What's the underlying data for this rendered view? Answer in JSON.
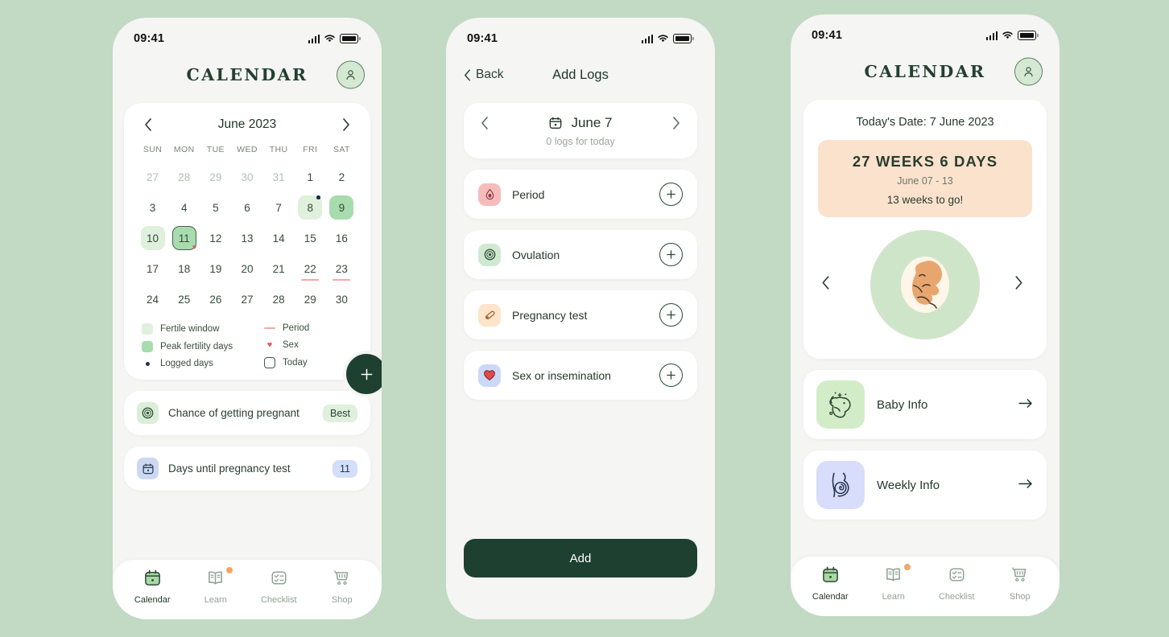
{
  "theme": {
    "background": "#c2d9c4",
    "screen_bg": "#f5f5f4",
    "accent_dark_green": "#1d4030",
    "fertile_green": "#dff0dd",
    "peak_green": "#a8dcae",
    "period_pink": "#f3a9a6",
    "peach": "#fbe2cd"
  },
  "status_bar": {
    "time": "09:41"
  },
  "phone1": {
    "header": {
      "title": "CALENDAR",
      "avatar_icon": "user-icon"
    },
    "calendar": {
      "prev_icon": "chevron-left-icon",
      "next_icon": "chevron-right-icon",
      "month_label": "June 2023",
      "weekday_headers": [
        "SUN",
        "MON",
        "TUE",
        "WED",
        "THU",
        "FRI",
        "SAT"
      ],
      "weeks": [
        [
          {
            "n": "27",
            "state": "muted"
          },
          {
            "n": "28",
            "state": "muted"
          },
          {
            "n": "29",
            "state": "muted"
          },
          {
            "n": "30",
            "state": "muted"
          },
          {
            "n": "31",
            "state": "muted"
          },
          {
            "n": "1",
            "state": ""
          },
          {
            "n": "2",
            "state": ""
          }
        ],
        [
          {
            "n": "3",
            "state": ""
          },
          {
            "n": "4",
            "state": ""
          },
          {
            "n": "5",
            "state": ""
          },
          {
            "n": "6",
            "state": ""
          },
          {
            "n": "7",
            "state": ""
          },
          {
            "n": "8",
            "state": "fertile",
            "dot": true
          },
          {
            "n": "9",
            "state": "peak"
          }
        ],
        [
          {
            "n": "10",
            "state": "fertile"
          },
          {
            "n": "11",
            "state": "today",
            "heart": true
          },
          {
            "n": "12",
            "state": ""
          },
          {
            "n": "13",
            "state": ""
          },
          {
            "n": "14",
            "state": ""
          },
          {
            "n": "15",
            "state": ""
          },
          {
            "n": "16",
            "state": ""
          }
        ],
        [
          {
            "n": "17",
            "state": ""
          },
          {
            "n": "18",
            "state": ""
          },
          {
            "n": "19",
            "state": ""
          },
          {
            "n": "20",
            "state": ""
          },
          {
            "n": "21",
            "state": ""
          },
          {
            "n": "22",
            "state": "",
            "period": true
          },
          {
            "n": "23",
            "state": "",
            "period": true
          }
        ],
        [
          {
            "n": "24",
            "state": ""
          },
          {
            "n": "25",
            "state": ""
          },
          {
            "n": "26",
            "state": ""
          },
          {
            "n": "27",
            "state": ""
          },
          {
            "n": "28",
            "state": ""
          },
          {
            "n": "29",
            "state": ""
          },
          {
            "n": "30",
            "state": ""
          }
        ]
      ],
      "legend_left": [
        {
          "type": "fertile",
          "label": "Fertile window"
        },
        {
          "type": "peak",
          "label": "Peak fertility days"
        },
        {
          "type": "dot",
          "label": "Logged days"
        }
      ],
      "legend_right": [
        {
          "type": "line",
          "label": "Period"
        },
        {
          "type": "heart",
          "label": "Sex"
        },
        {
          "type": "today",
          "label": "Today"
        }
      ],
      "fab_label": "+",
      "fab_icon": "plus-icon"
    },
    "info_rows": [
      {
        "icon": "ovulation-icon",
        "icon_style": "ib-green",
        "label": "Chance of getting pregnant",
        "badge": "Best",
        "badge_style": "badge-green"
      },
      {
        "icon": "calendar-icon",
        "icon_style": "ib-blue",
        "label": "Days until pregnancy test",
        "badge": "11",
        "badge_style": "badge-blue"
      }
    ],
    "tabs": [
      {
        "label": "Calendar",
        "icon": "calendar-icon",
        "active": true,
        "badge": false
      },
      {
        "label": "Learn",
        "icon": "book-icon",
        "active": false,
        "badge": true
      },
      {
        "label": "Checklist",
        "icon": "checklist-icon",
        "active": false,
        "badge": false
      },
      {
        "label": "Shop",
        "icon": "cart-icon",
        "active": false,
        "badge": false
      }
    ]
  },
  "phone2": {
    "header": {
      "back_label": "Back",
      "back_icon": "chevron-left-icon",
      "title": "Add Logs"
    },
    "date_selector": {
      "prev_icon": "chevron-left-icon",
      "next_icon": "chevron-right-icon",
      "calendar_icon": "calendar-icon",
      "date": "June 7",
      "subtitle": "0 logs for today"
    },
    "log_items": [
      {
        "label": "Period",
        "icon": "droplet-icon",
        "icon_style": "li-pink",
        "add_icon": "plus-icon"
      },
      {
        "label": "Ovulation",
        "icon": "ovulation-icon",
        "icon_style": "li-green",
        "add_icon": "plus-icon"
      },
      {
        "label": "Pregnancy test",
        "icon": "test-stick-icon",
        "icon_style": "li-peach",
        "add_icon": "plus-icon"
      },
      {
        "label": "Sex or insemination",
        "icon": "heart-icon",
        "icon_style": "li-blue",
        "add_icon": "plus-icon"
      }
    ],
    "add_button": "Add"
  },
  "phone3": {
    "header": {
      "title": "CALENDAR",
      "avatar_icon": "user-icon"
    },
    "pregnancy": {
      "today_date": "Today's Date: 7 June 2023",
      "weeks_big": "27  WEEKS  6  DAYS",
      "weeks_range": "June 07 - 13",
      "weeks_togo": "13 weeks to go!",
      "prev_icon": "chevron-left-icon",
      "next_icon": "chevron-right-icon",
      "illustration": "fetus-illustration"
    },
    "links": [
      {
        "label": "Baby Info",
        "icon": "fetus-icon",
        "icon_style": "lk-green",
        "arrow_icon": "arrow-right-icon"
      },
      {
        "label": "Weekly Info",
        "icon": "belly-icon",
        "icon_style": "lk-blue",
        "arrow_icon": "arrow-right-icon"
      }
    ],
    "tabs": [
      {
        "label": "Calendar",
        "icon": "calendar-icon",
        "active": true,
        "badge": false
      },
      {
        "label": "Learn",
        "icon": "book-icon",
        "active": false,
        "badge": true
      },
      {
        "label": "Checklist",
        "icon": "checklist-icon",
        "active": false,
        "badge": false
      },
      {
        "label": "Shop",
        "icon": "cart-icon",
        "active": false,
        "badge": false
      }
    ]
  }
}
